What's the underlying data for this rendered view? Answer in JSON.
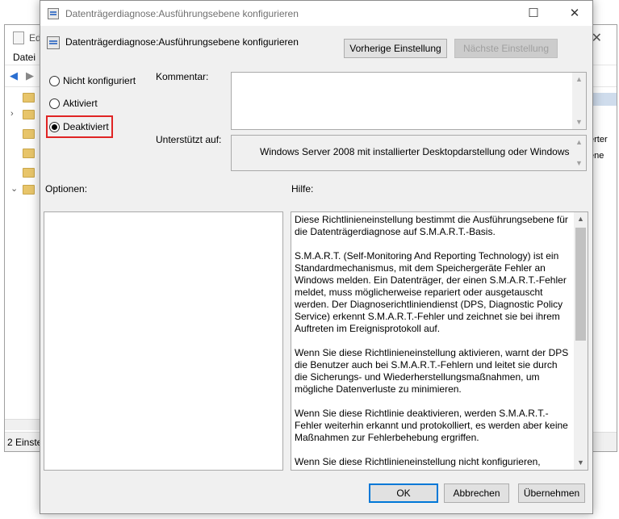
{
  "background_window": {
    "title": "Edi",
    "menu_file": "Datei",
    "right_text_1": "erter",
    "right_text_2": "ene",
    "status": "2 Einstel"
  },
  "dialog": {
    "title": "Datenträgerdiagnose:Ausführungsebene konfigurieren",
    "header_title": "Datenträgerdiagnose:Ausführungsebene konfigurieren",
    "prev_button": "Vorherige Einstellung",
    "next_button": "Nächste Einstellung",
    "radio": {
      "not_configured": "Nicht konfiguriert",
      "enabled": "Aktiviert",
      "disabled": "Deaktiviert",
      "selected": "disabled"
    },
    "comment_label": "Kommentar:",
    "supported_label": "Unterstützt auf:",
    "supported_value": "Windows Server 2008 mit installierter Desktopdarstellung oder Windows",
    "options_label": "Optionen:",
    "help_label": "Hilfe:",
    "help_paragraphs": [
      "Diese Richtlinieneinstellung bestimmt die Ausführungsebene für die Datenträgerdiagnose auf S.M.A.R.T.-Basis.",
      "S.M.A.R.T. (Self-Monitoring And Reporting Technology) ist ein Standardmechanismus, mit dem Speichergeräte Fehler an Windows melden. Ein Datenträger, der einen S.M.A.R.T.-Fehler meldet, muss möglicherweise repariert oder ausgetauscht werden. Der Diagnoserichtliniendienst (DPS, Diagnostic Policy Service) erkennt S.M.A.R.T.-Fehler und zeichnet sie bei ihrem Auftreten im Ereignisprotokoll auf.",
      "Wenn Sie diese Richtlinieneinstellung aktivieren, warnt der DPS die Benutzer auch bei S.M.A.R.T.-Fehlern und leitet sie durch die Sicherungs- und Wiederherstellungsmaßnahmen, um mögliche Datenverluste zu minimieren.",
      "Wenn Sie diese Richtlinie deaktivieren, werden S.M.A.R.T.-Fehler weiterhin erkannt und protokolliert, es werden aber keine Maßnahmen zur Fehlerbehebung ergriffen.",
      "Wenn Sie diese Richtlinieneinstellung nicht konfigurieren,"
    ],
    "ok_button": "OK",
    "cancel_button": "Abbrechen",
    "apply_button": "Übernehmen"
  },
  "colors": {
    "highlight_border": "#e02424",
    "default_button_border": "#0078d7"
  }
}
